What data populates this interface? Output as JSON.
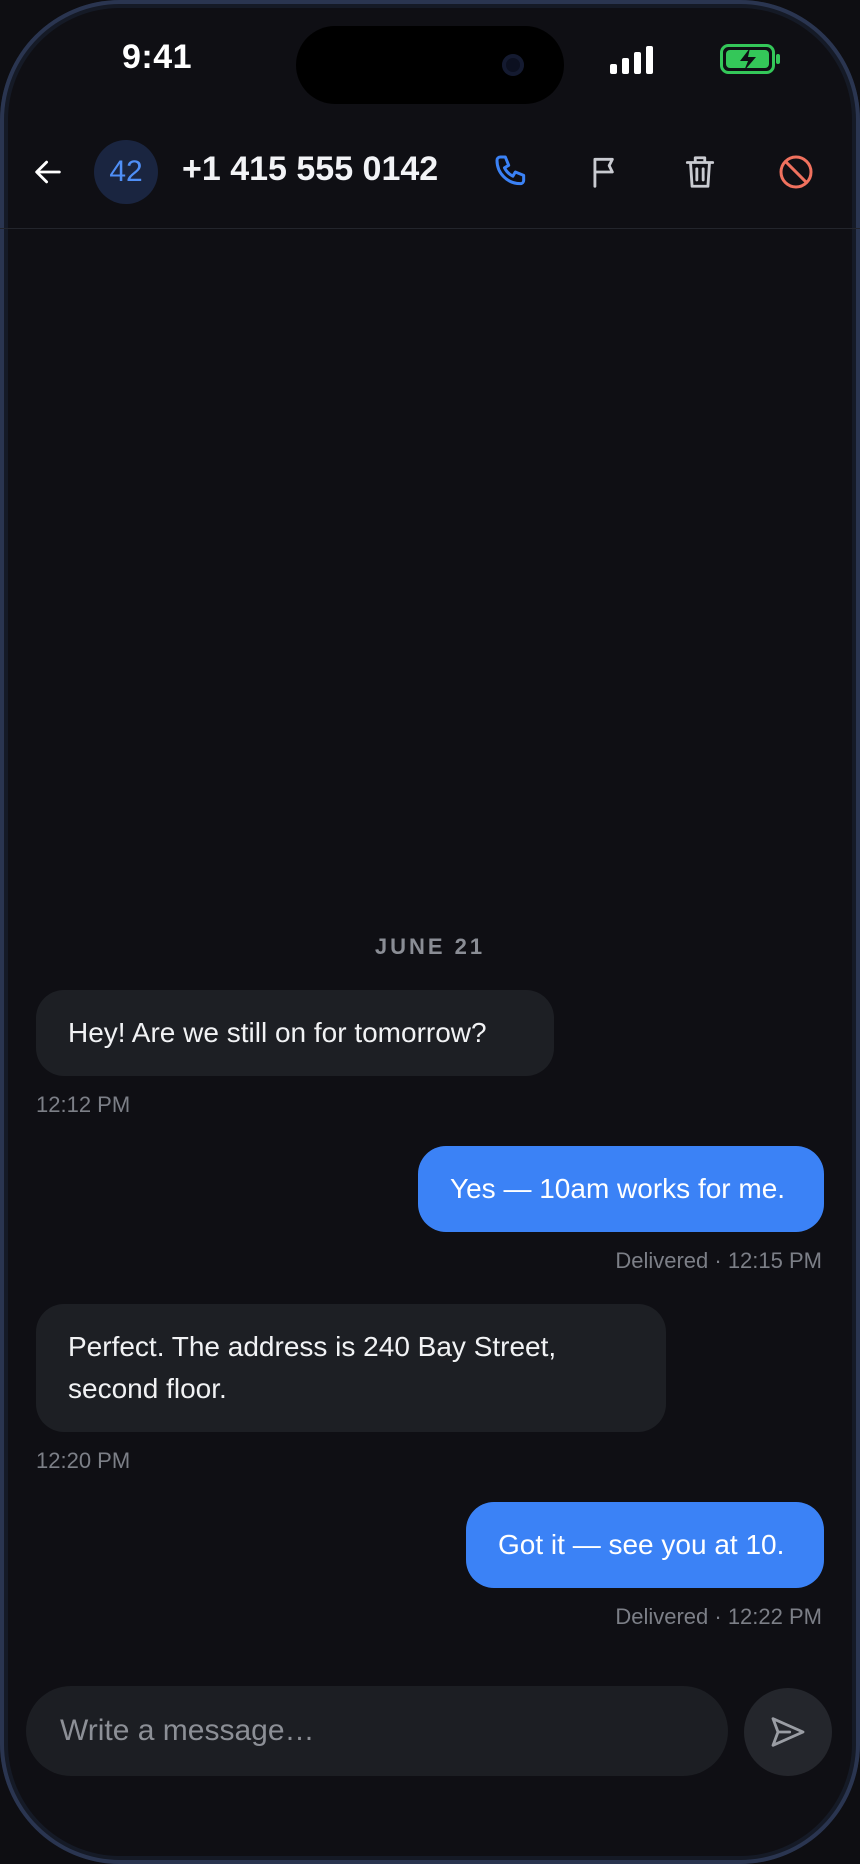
{
  "status_bar": {
    "time": "9:41",
    "signal_icon": "signal-bars-icon",
    "battery_icon": "battery-charging-icon",
    "battery_color": "#34c759"
  },
  "header": {
    "avatar_text": "42",
    "title": "+1 415 555 0142",
    "icons": {
      "back": "arrow-left-icon",
      "call": "phone-icon",
      "flag": "flag-icon",
      "delete": "trash-icon",
      "block": "block-icon"
    },
    "colors": {
      "accent": "#3b82f6",
      "block": "#f0715e"
    }
  },
  "thread": {
    "date_label": "JUNE 21",
    "messages": [
      {
        "direction": "incoming",
        "text": "Hey! Are we still on for tomorrow?",
        "meta": "12:12 PM"
      },
      {
        "direction": "outgoing",
        "text": "Yes — 10am works for me.",
        "meta": "Delivered · 12:15 PM"
      },
      {
        "direction": "incoming",
        "text": "Perfect. The address is 240 Bay Street, second floor.",
        "meta": "12:20 PM"
      },
      {
        "direction": "outgoing",
        "text": "Got it — see you at 10.",
        "meta": "Delivered · 12:22 PM"
      }
    ]
  },
  "composer": {
    "placeholder": "Write a message…",
    "value": "",
    "send_icon": "send-icon"
  }
}
